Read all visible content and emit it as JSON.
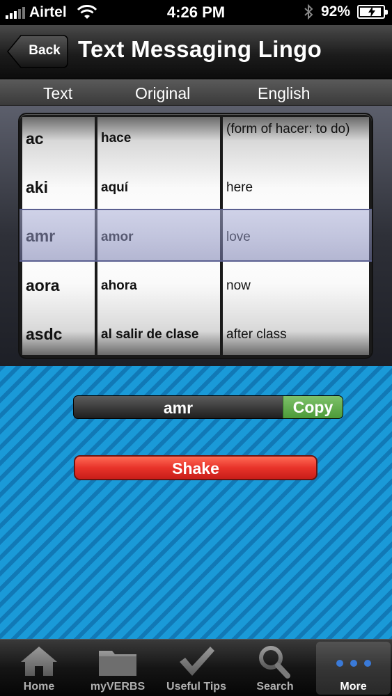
{
  "status_bar": {
    "carrier": "Airtel",
    "time": "4:26 PM",
    "battery": "92%"
  },
  "nav": {
    "back_label": "Back",
    "title": "Text Messaging Lingo"
  },
  "columns": {
    "text": "Text",
    "original": "Original",
    "english": "English"
  },
  "picker": {
    "rows": [
      {
        "text": "ac",
        "original": "hace",
        "english": "(form of hacer: to do)"
      },
      {
        "text": "aki",
        "original": "aquí",
        "english": "here"
      },
      {
        "text": "amr",
        "original": "amor",
        "english": "love"
      },
      {
        "text": "aora",
        "original": "ahora",
        "english": "now"
      },
      {
        "text": "asdc",
        "original": "al salir de clase",
        "english": "after class"
      }
    ],
    "selected_index": 2
  },
  "result": {
    "value": "amr",
    "copy_label": "Copy",
    "shake_label": "Shake"
  },
  "tabs": [
    {
      "label": "Home",
      "icon": "home-icon"
    },
    {
      "label": "myVERBS",
      "icon": "folder-icon"
    },
    {
      "label": "Useful Tips",
      "icon": "checkmark-icon"
    },
    {
      "label": "Search",
      "icon": "search-icon"
    },
    {
      "label": "More",
      "icon": "more-icon",
      "active": true
    }
  ],
  "colors": {
    "copy_green": "#5aa845",
    "shake_red": "#e8332a",
    "background_blue": "#1a9ad8"
  }
}
